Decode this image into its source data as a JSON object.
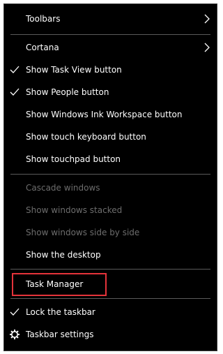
{
  "menu": {
    "items": [
      {
        "label": "Toolbars",
        "checked": false,
        "submenu": true,
        "disabled": false
      },
      {
        "label": "Cortana",
        "checked": false,
        "submenu": true,
        "disabled": false
      },
      {
        "label": "Show Task View button",
        "checked": true,
        "submenu": false,
        "disabled": false
      },
      {
        "label": "Show People button",
        "checked": true,
        "submenu": false,
        "disabled": false
      },
      {
        "label": "Show Windows Ink Workspace button",
        "checked": false,
        "submenu": false,
        "disabled": false
      },
      {
        "label": "Show touch keyboard button",
        "checked": false,
        "submenu": false,
        "disabled": false
      },
      {
        "label": "Show touchpad button",
        "checked": false,
        "submenu": false,
        "disabled": false
      },
      {
        "label": "Cascade windows",
        "checked": false,
        "submenu": false,
        "disabled": true
      },
      {
        "label": "Show windows stacked",
        "checked": false,
        "submenu": false,
        "disabled": true
      },
      {
        "label": "Show windows side by side",
        "checked": false,
        "submenu": false,
        "disabled": true
      },
      {
        "label": "Show the desktop",
        "checked": false,
        "submenu": false,
        "disabled": false
      },
      {
        "label": "Task Manager",
        "checked": false,
        "submenu": false,
        "disabled": false,
        "highlighted": true
      },
      {
        "label": "Lock the taskbar",
        "checked": true,
        "submenu": false,
        "disabled": false
      },
      {
        "label": "Taskbar settings",
        "checked": false,
        "submenu": false,
        "disabled": false,
        "icon": "gear-icon"
      }
    ]
  },
  "colors": {
    "background": "#000000",
    "text": "#ffffff",
    "disabled_text": "#6d6d6d",
    "separator": "#5a5a5a",
    "highlight_border": "#e5333a"
  }
}
